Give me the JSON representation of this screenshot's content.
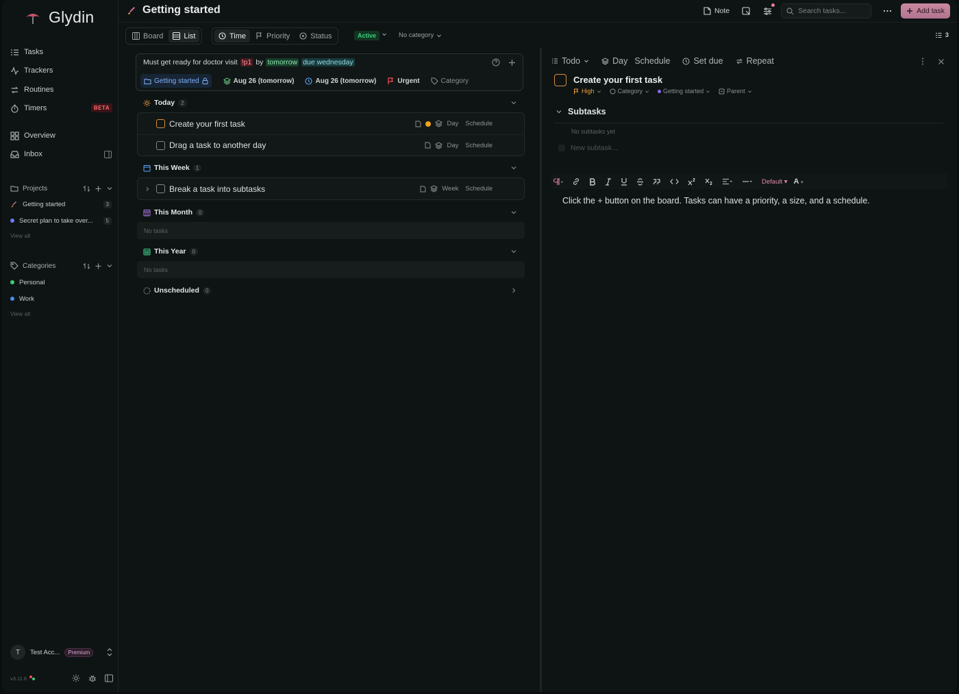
{
  "app": {
    "name": "Glydin",
    "version": "v3.11.6"
  },
  "sidebar": {
    "nav": [
      {
        "label": "Tasks",
        "icon": "tasks-icon"
      },
      {
        "label": "Trackers",
        "icon": "activity-icon"
      },
      {
        "label": "Routines",
        "icon": "repeat-icon"
      },
      {
        "label": "Timers",
        "icon": "timer-icon",
        "badge": "BETA"
      },
      {
        "label": "Overview",
        "icon": "grid-icon"
      },
      {
        "label": "Inbox",
        "icon": "inbox-icon"
      }
    ],
    "projects": {
      "title": "Projects",
      "items": [
        {
          "label": "Getting started",
          "count": "3",
          "icon": "rocket-icon"
        },
        {
          "label": "Secret plan to take over...",
          "count": "5",
          "color": "#6b7cf0"
        }
      ],
      "view_all": "View all"
    },
    "categories": {
      "title": "Categories",
      "items": [
        {
          "label": "Personal",
          "color": "#3fcf6f"
        },
        {
          "label": "Work",
          "color": "#4a8ef0"
        }
      ],
      "view_all": "View all"
    },
    "account": {
      "initial": "T",
      "name": "Test Acc...",
      "plan": "Premium"
    }
  },
  "header": {
    "title": "Getting started",
    "note_label": "Note",
    "search_placeholder": "Search tasks...",
    "add_task_label": "Add task"
  },
  "toolbar": {
    "views": [
      "Board",
      "List"
    ],
    "active_view": "List",
    "group_by": [
      "Time",
      "Priority",
      "Status"
    ],
    "active_group": "Time",
    "filter_status": "Active",
    "filter_category": "No category",
    "count": "3"
  },
  "quick_add": {
    "text_plain_1": "Must get ready for doctor visit",
    "text_priority": "!p1",
    "text_plain_2": "by",
    "text_date": "tomorrow",
    "text_due": "due wednesday",
    "chips": {
      "project": "Getting started",
      "schedule": "Aug 26 (tomorrow)",
      "due": "Aug 26 (tomorrow)",
      "priority": "Urgent",
      "category": "Category"
    }
  },
  "groups": {
    "today": {
      "label": "Today",
      "count": "2",
      "tasks": [
        {
          "title": "Create your first task",
          "size": "Day",
          "schedule": "Schedule"
        },
        {
          "title": "Drag a task to another day",
          "size": "Day",
          "schedule": "Schedule"
        }
      ]
    },
    "week": {
      "label": "This Week",
      "count": "1",
      "tasks": [
        {
          "title": "Break a task into subtasks",
          "size": "Week",
          "schedule": "Schedule"
        }
      ]
    },
    "month": {
      "label": "This Month",
      "count": "0",
      "empty": "No tasks"
    },
    "year": {
      "label": "This Year",
      "count": "0",
      "empty": "No tasks"
    },
    "unscheduled": {
      "label": "Unscheduled",
      "count": "0"
    }
  },
  "detail": {
    "status": "Todo",
    "size": "Day",
    "schedule": "Schedule",
    "due": "Set due",
    "repeat": "Repeat",
    "title": "Create your first task",
    "priority": "High",
    "category": "Category",
    "project": "Getting started",
    "parent": "Parent",
    "subtasks_title": "Subtasks",
    "no_subtasks": "No subtasks yet",
    "new_subtask_placeholder": "New subtask...",
    "editor_style": "Default",
    "editor_color": "A",
    "body": "Click the + button on the board. Tasks can have a priority, a size, and a schedule."
  },
  "colors": {
    "accent": "#c9899f",
    "orange": "#d98b3c",
    "active_green": "#39d07a",
    "project_blue": "#7fb4ff"
  }
}
